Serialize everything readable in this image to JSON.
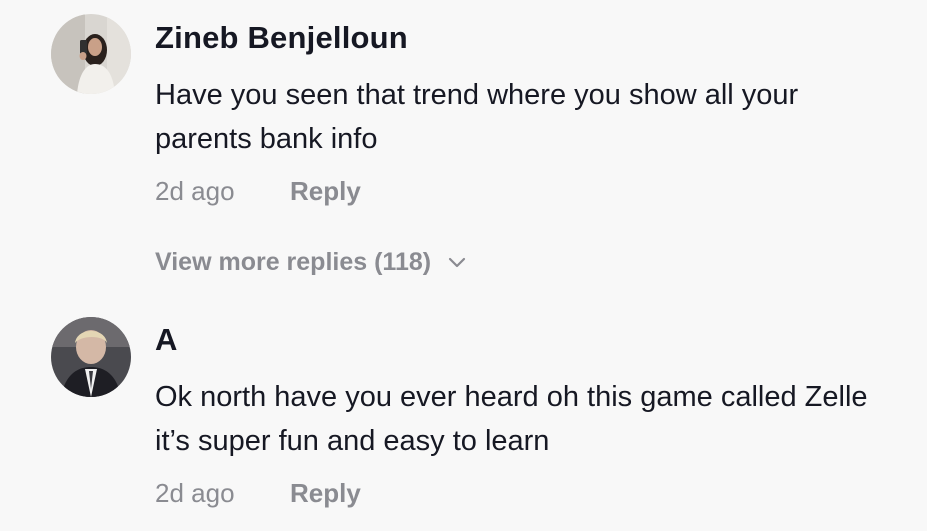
{
  "comments": [
    {
      "username": "Zineb Benjelloun",
      "avatar_icon": "user-avatar",
      "text": "Have you seen that trend where you show all your parents bank info",
      "time": "2d ago",
      "reply_label": "Reply",
      "more_replies_label": "View more replies (118)",
      "more_replies_icon": "chevron-down-icon"
    },
    {
      "username": "A",
      "avatar_icon": "user-avatar",
      "text": "Ok north have you ever heard oh this game called Zelle it’s super fun and easy to learn",
      "time": "2d ago",
      "reply_label": "Reply"
    }
  ],
  "colors": {
    "background": "#f8f8f8",
    "primary_text": "#161823",
    "secondary_text": "#8a8b91"
  }
}
